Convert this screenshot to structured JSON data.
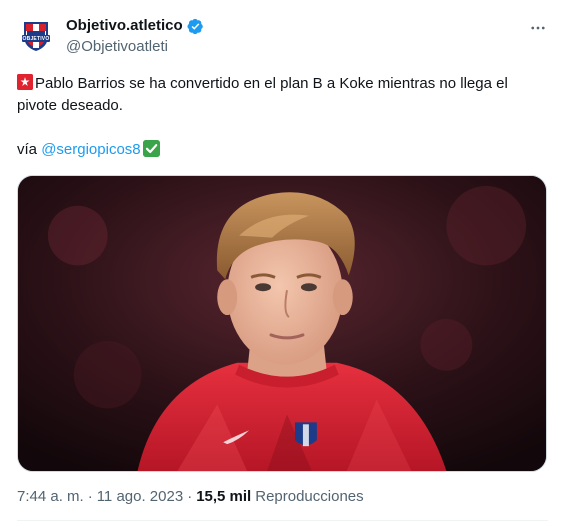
{
  "author": {
    "display_name": "Objetivo.atletico",
    "handle": "@Objetivoatleti",
    "verified": true,
    "avatar_text": "OBJETIVO"
  },
  "tweet": {
    "text_main": "Pablo Barrios se ha convertido en el plan B a Koke mientras no llega el pivote deseado.",
    "via_prefix": "vía ",
    "mention": "@sergiopicos8"
  },
  "meta": {
    "time": "7:44 a. m.",
    "separator": "·",
    "date": "11 ago. 2023",
    "views_count": "15,5 mil",
    "views_label": "Reproducciones"
  },
  "icons": {
    "verified": "verified-badge-icon",
    "more": "more-options-icon",
    "flag": "red-flag-emoji-icon",
    "check": "check-mark-emoji-icon"
  },
  "colors": {
    "text": "#0f1419",
    "secondary": "#536471",
    "link": "#1d9bf0",
    "border": "#cfd9de"
  }
}
